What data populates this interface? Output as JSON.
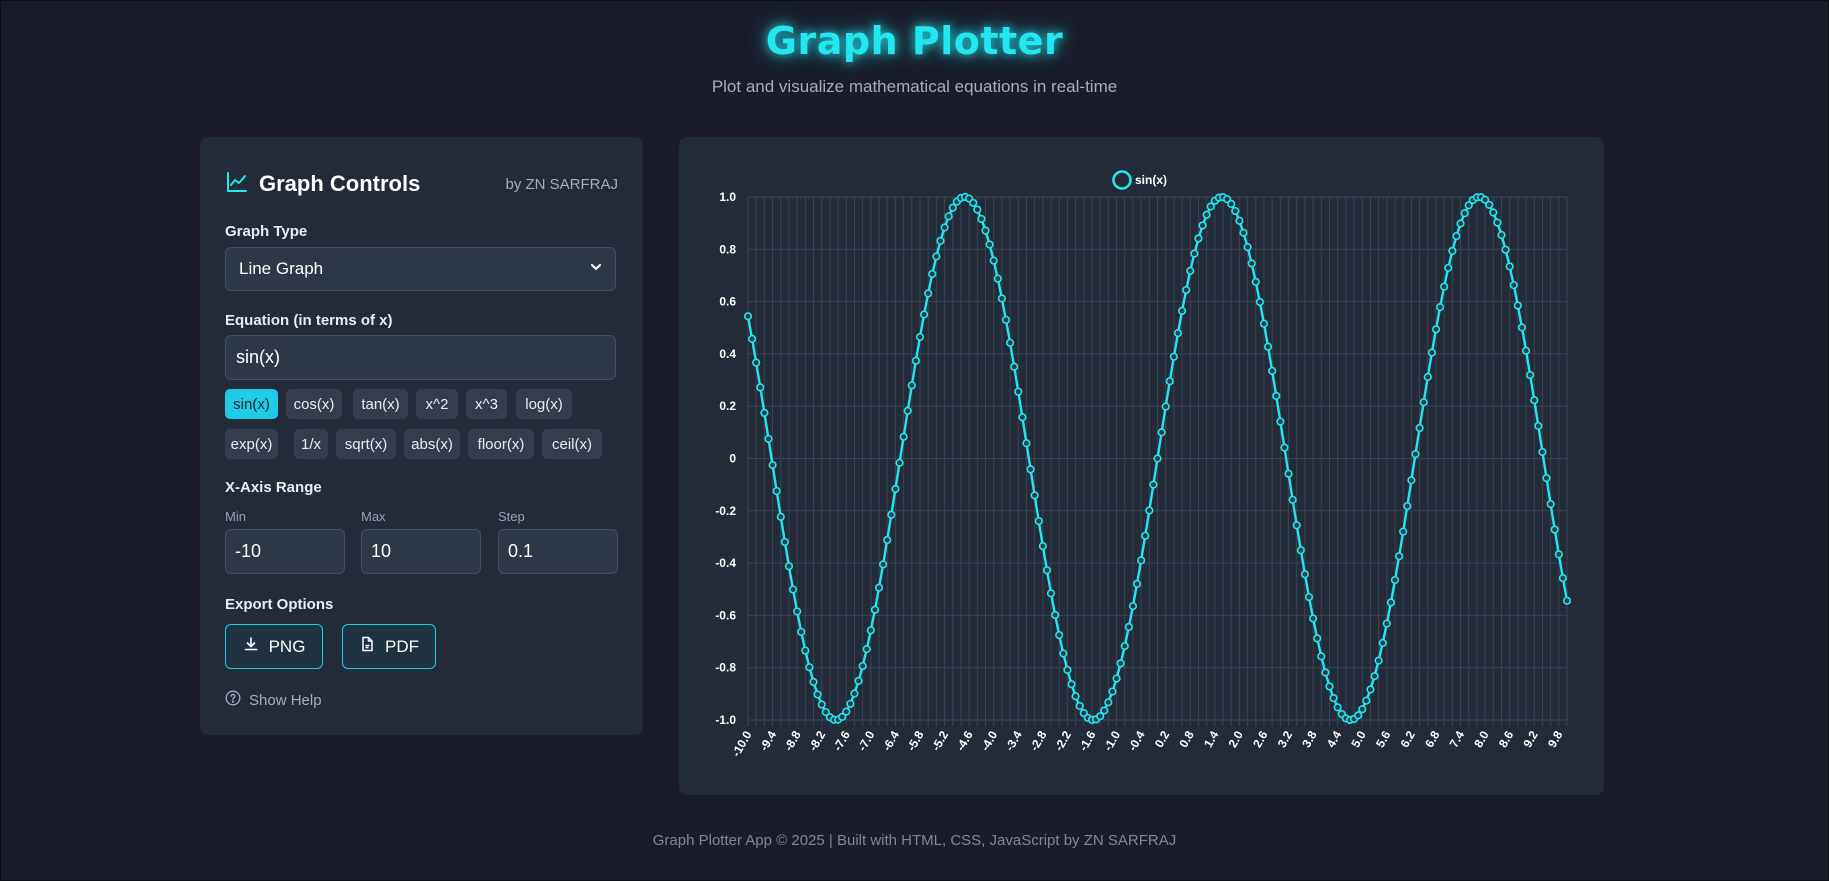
{
  "header": {
    "title": "Graph Plotter",
    "subtitle": "Plot and visualize mathematical equations in real-time"
  },
  "controls": {
    "title": "Graph Controls",
    "author": "by ZN SARFRAJ",
    "graph_type_label": "Graph Type",
    "graph_type_value": "Line Graph",
    "equation_label": "Equation (in terms of x)",
    "equation_value": "sin(x)",
    "function_chips": [
      "sin(x)",
      "cos(x)",
      "tan(x)",
      "x^2",
      "x^3",
      "log(x)",
      "exp(x)",
      "1/x",
      "sqrt(x)",
      "abs(x)",
      "floor(x)",
      "ceil(x)"
    ],
    "active_chip": "sin(x)",
    "x_axis_label": "X-Axis Range",
    "min_label": "Min",
    "min_value": "-10",
    "max_label": "Max",
    "max_value": "10",
    "step_label": "Step",
    "step_value": "0.1",
    "export_label": "Export Options",
    "png_label": "PNG",
    "pdf_label": "PDF",
    "help_label": "Show Help"
  },
  "colors": {
    "accent": "#22e6f0",
    "chip_active": "#1fcbe6",
    "panel": "#232b38",
    "background": "#1a1d29"
  },
  "icons": {
    "panel": "line-chart-icon",
    "select": "chevron-down-icon",
    "png": "download-icon",
    "pdf": "file-pdf-icon",
    "help": "question-circle-icon"
  },
  "chart_data": {
    "type": "line",
    "series": [
      {
        "name": "sin(x)",
        "function": "sin(x)",
        "x_min": -10,
        "x_max": 10,
        "step": 0.1
      }
    ],
    "x_ticks": [
      "-10.0",
      "-9.4",
      "-8.8",
      "-8.2",
      "-7.6",
      "-7.0",
      "-6.4",
      "-5.8",
      "-5.2",
      "-4.6",
      "-4.0",
      "-3.4",
      "-2.8",
      "-2.2",
      "-1.6",
      "-1.0",
      "-0.4",
      "0.2",
      "0.8",
      "1.4",
      "2.0",
      "2.6",
      "3.2",
      "3.8",
      "4.4",
      "5.0",
      "5.6",
      "6.2",
      "6.8",
      "7.4",
      "8.0",
      "8.6",
      "9.2",
      "9.8"
    ],
    "y_ticks": [
      "1.0",
      "0.8",
      "0.6",
      "0.4",
      "0.2",
      "0",
      "-0.2",
      "-0.4",
      "-0.6",
      "-0.8",
      "-1.0"
    ],
    "ylim": [
      -1,
      1
    ],
    "xlim": [
      -10,
      10
    ],
    "grid": true,
    "legend": "top-center",
    "line_color": "#22e6f0"
  },
  "footer": "Graph Plotter App © 2025 | Built with HTML, CSS, JavaScript by ZN SARFRAJ"
}
